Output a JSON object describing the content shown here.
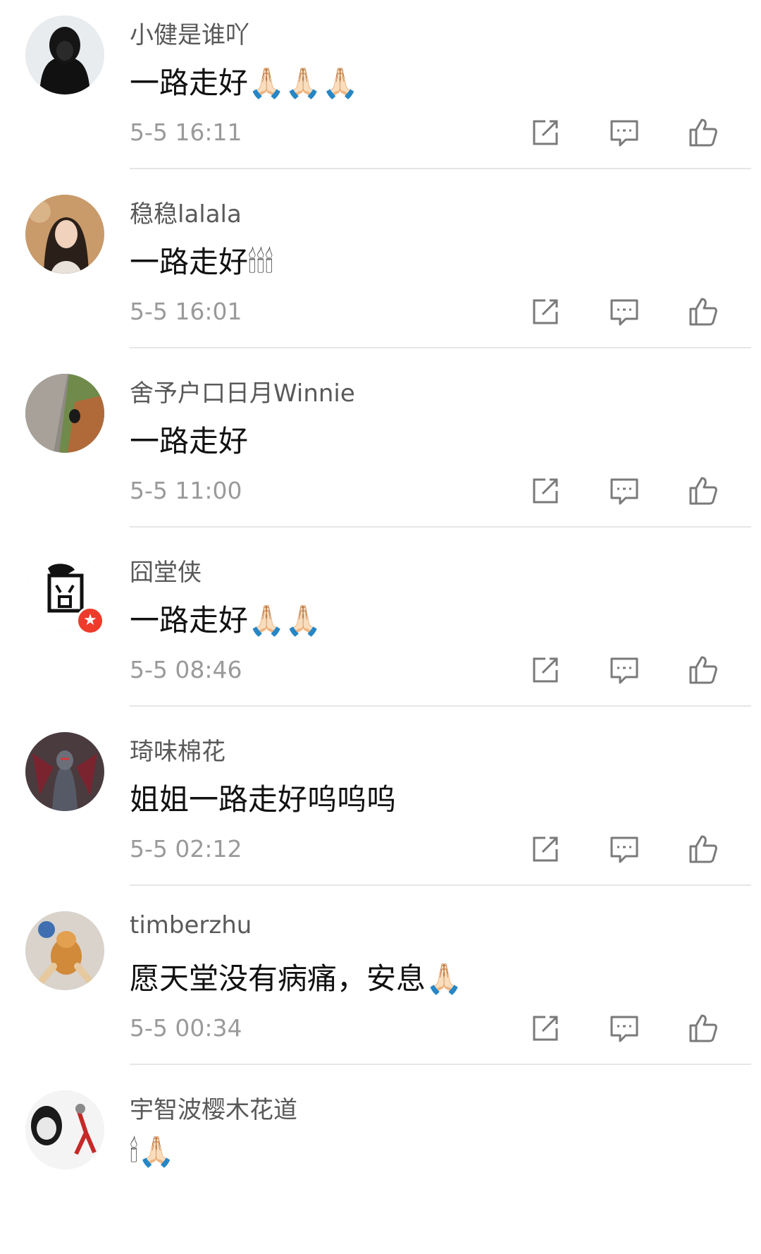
{
  "comments": [
    {
      "username": "小健是谁吖",
      "text": "一路走好🙏🏻🙏🏻🙏🏻",
      "time": "5-5 16:11",
      "avatar": "person-black-hood"
    },
    {
      "username": "稳稳lalala",
      "text": "一路走好🕯🕯🕯",
      "time": "5-5 16:01",
      "avatar": "girl-portrait"
    },
    {
      "username": "舍予户口日月Winnie",
      "text": "一路走好",
      "time": "5-5 11:00",
      "avatar": "street-cat"
    },
    {
      "username": "囧堂侠",
      "text": "一路走好🙏🏻🙏🏻",
      "time": "5-5 08:46",
      "avatar": "jiong-logo",
      "badge": "★"
    },
    {
      "username": "琦味棉花",
      "text": "姐姐一路走好呜呜呜",
      "time": "5-5 02:12",
      "avatar": "armored-hero"
    },
    {
      "username": "timberzhu",
      "text": "愿天堂没有病痛，安息🙏🏻",
      "time": "5-5 00:34",
      "avatar": "shiba-dog"
    },
    {
      "username": "宇智波樱木花道",
      "text": "🕯🙏🏻",
      "time": "",
      "avatar": "meme-face"
    }
  ],
  "icons": {
    "share": "share-icon",
    "reply": "comment-icon",
    "like": "thumbs-up-icon"
  },
  "colors": {
    "username": "#595959",
    "time": "#9a9a9a",
    "icon": "#7a7a7a",
    "divider": "#e6e6e6",
    "badge": "#ef3b2c"
  }
}
